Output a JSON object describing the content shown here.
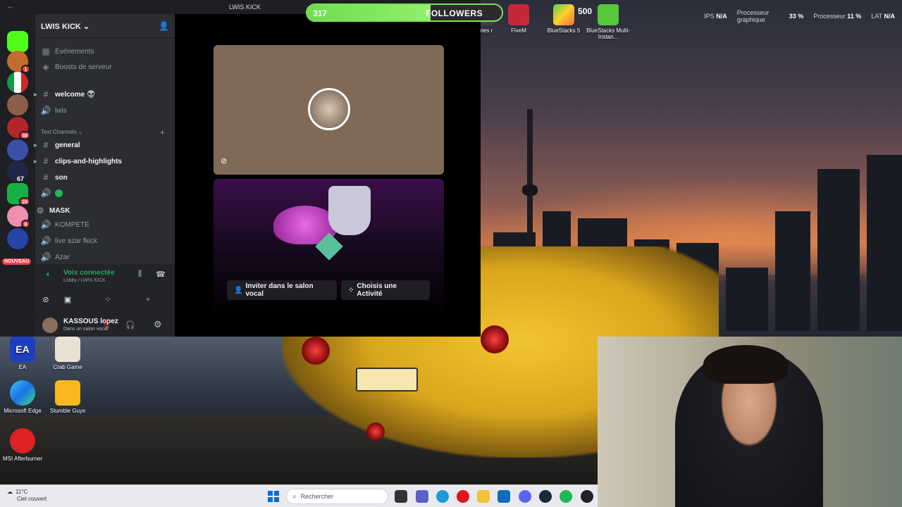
{
  "window": {
    "title": "LWIS KICK"
  },
  "server": {
    "name": "LWIS KICK"
  },
  "server_rail": {
    "badges": [
      "1",
      "39",
      "67",
      "20",
      "6"
    ],
    "new_label": "NOUVEAU"
  },
  "channels": {
    "events": "Événements",
    "boosts": "Boosts de serveur",
    "welcome": "welcome 👽",
    "lwis": "lwis",
    "category": "Text Channels",
    "general": "general",
    "clips": "clips-and-highlights",
    "son": "son",
    "mask": "MASK",
    "kompete": "KOMPETE",
    "live": "live azar fkick",
    "azar": "Azar"
  },
  "voice": {
    "status": "Voix connectée",
    "location": "Lobby / LWIS KICK"
  },
  "user": {
    "name": "KASSOUS lopez",
    "status": "Dans un salon vocal"
  },
  "activity": {
    "invite_label": "Inviter dans le salon vocal",
    "activity_label": "Choisis une Activité"
  },
  "overlay": {
    "followers_current": "317",
    "followers_label": "FOLLOWERS",
    "followers_goal": "500",
    "followers_progress": 0.634
  },
  "top_apps": [
    {
      "label": "ames\nr"
    },
    {
      "label": "FiveM"
    },
    {
      "label": "BlueStacks 5"
    },
    {
      "label": "BlueStacks Multi-Instan..."
    }
  ],
  "stats": {
    "ips_label": "IPS",
    "ips_value": "N/A",
    "gpu_label": "Processeur graphique",
    "gpu_value": "33 %",
    "cpu_label": "Processeur",
    "cpu_value": "11 %",
    "lat_label": "LAT",
    "lat_value": "N/A"
  },
  "desktop_icons": [
    {
      "label": "EA"
    },
    {
      "label": "Crab Game"
    },
    {
      "label": "Microsoft Edge"
    },
    {
      "label": "Stumble Guys"
    },
    {
      "label": "MSI Afterburner"
    }
  ],
  "taskbar": {
    "temperature": "11°C",
    "weather": "Ciel couvert",
    "search_placeholder": "Rechercher"
  },
  "colors": {
    "discord_bg": "#2b2d31",
    "voice_green": "#23a55a",
    "followers_green": "#6fdc52",
    "danger_red": "#f23f43"
  }
}
